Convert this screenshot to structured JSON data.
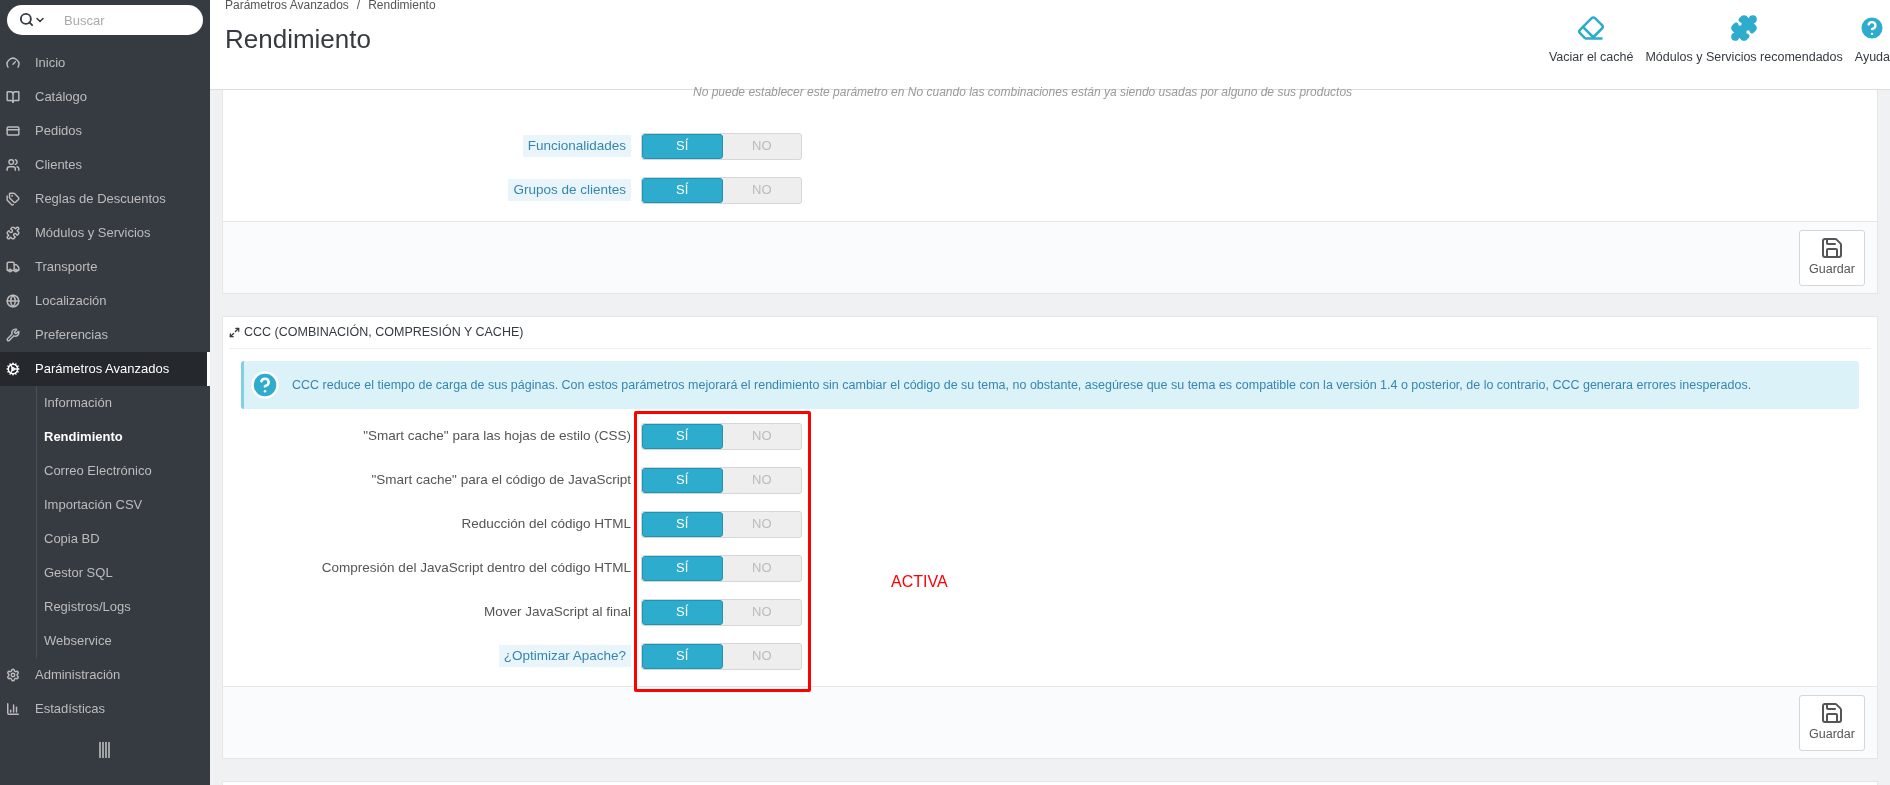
{
  "sidebar": {
    "search": {
      "placeholder": "Buscar"
    },
    "items": [
      {
        "label": "Inicio",
        "selected": false
      },
      {
        "label": "Catálogo",
        "selected": false
      },
      {
        "label": "Pedidos",
        "selected": false
      },
      {
        "label": "Clientes",
        "selected": false
      },
      {
        "label": "Reglas de Descuentos",
        "selected": false
      },
      {
        "label": "Módulos y Servicios",
        "selected": false
      },
      {
        "label": "Transporte",
        "selected": false
      },
      {
        "label": "Localización",
        "selected": false
      },
      {
        "label": "Preferencias",
        "selected": false
      },
      {
        "label": "Parámetros Avanzados",
        "selected": true,
        "children": [
          {
            "label": "Información",
            "selected": false
          },
          {
            "label": "Rendimiento",
            "selected": true
          },
          {
            "label": "Correo Electrónico",
            "selected": false
          },
          {
            "label": "Importación CSV",
            "selected": false
          },
          {
            "label": "Copia BD",
            "selected": false
          },
          {
            "label": "Gestor SQL",
            "selected": false
          },
          {
            "label": "Registros/Logs",
            "selected": false
          },
          {
            "label": "Webservice",
            "selected": false
          }
        ]
      },
      {
        "label": "Administración",
        "selected": false
      },
      {
        "label": "Estadísticas",
        "selected": false
      }
    ]
  },
  "header": {
    "breadcrumb": [
      "Parámetros Avanzados",
      "/",
      "Rendimiento"
    ],
    "title": "Rendimiento",
    "toolbar": [
      {
        "label": "Vaciar el caché"
      },
      {
        "label": "Módulos y Servicios recomendados"
      },
      {
        "label": "Ayuda"
      }
    ]
  },
  "panels": [
    {
      "note": "No puede establecer este parámetro en No cuando las combinaciones están ya siendo usadas por alguno de sus productos",
      "rows": [
        {
          "label": "Funcionalidades",
          "help": true,
          "on": true,
          "yes": "SÍ",
          "no": "NO"
        },
        {
          "label": "Grupos de clientes",
          "help": true,
          "on": true,
          "yes": "SÍ",
          "no": "NO"
        }
      ],
      "save": "Guardar"
    },
    {
      "heading": "CCC (COMBINACIÓN, COMPRESIÓN Y CACHE)",
      "info": "CCC reduce el tiempo de carga de sus páginas. Con estos parámetros mejorará el rendimiento sin cambiar el código de su tema, no obstante, asegúrese que su tema es compatible con la versión 1.4 o posterior, de lo contrario, CCC generara errores inesperados.",
      "rows": [
        {
          "label": "\"Smart cache\" para las hojas de estilo (CSS)",
          "help": false,
          "on": true,
          "yes": "SÍ",
          "no": "NO"
        },
        {
          "label": "\"Smart cache\" para el código de JavaScript",
          "help": false,
          "on": true,
          "yes": "SÍ",
          "no": "NO"
        },
        {
          "label": "Reducción del código HTML",
          "help": false,
          "on": true,
          "yes": "SÍ",
          "no": "NO"
        },
        {
          "label": "Compresión del JavaScript dentro del código HTML",
          "help": false,
          "on": true,
          "yes": "SÍ",
          "no": "NO"
        },
        {
          "label": "Mover JavaScript al final",
          "help": false,
          "on": true,
          "yes": "SÍ",
          "no": "NO"
        },
        {
          "label": "¿Optimizar Apache?",
          "help": true,
          "on": true,
          "yes": "SÍ",
          "no": "NO"
        }
      ],
      "annotation": "ACTIVA",
      "save": "Guardar"
    }
  ]
}
